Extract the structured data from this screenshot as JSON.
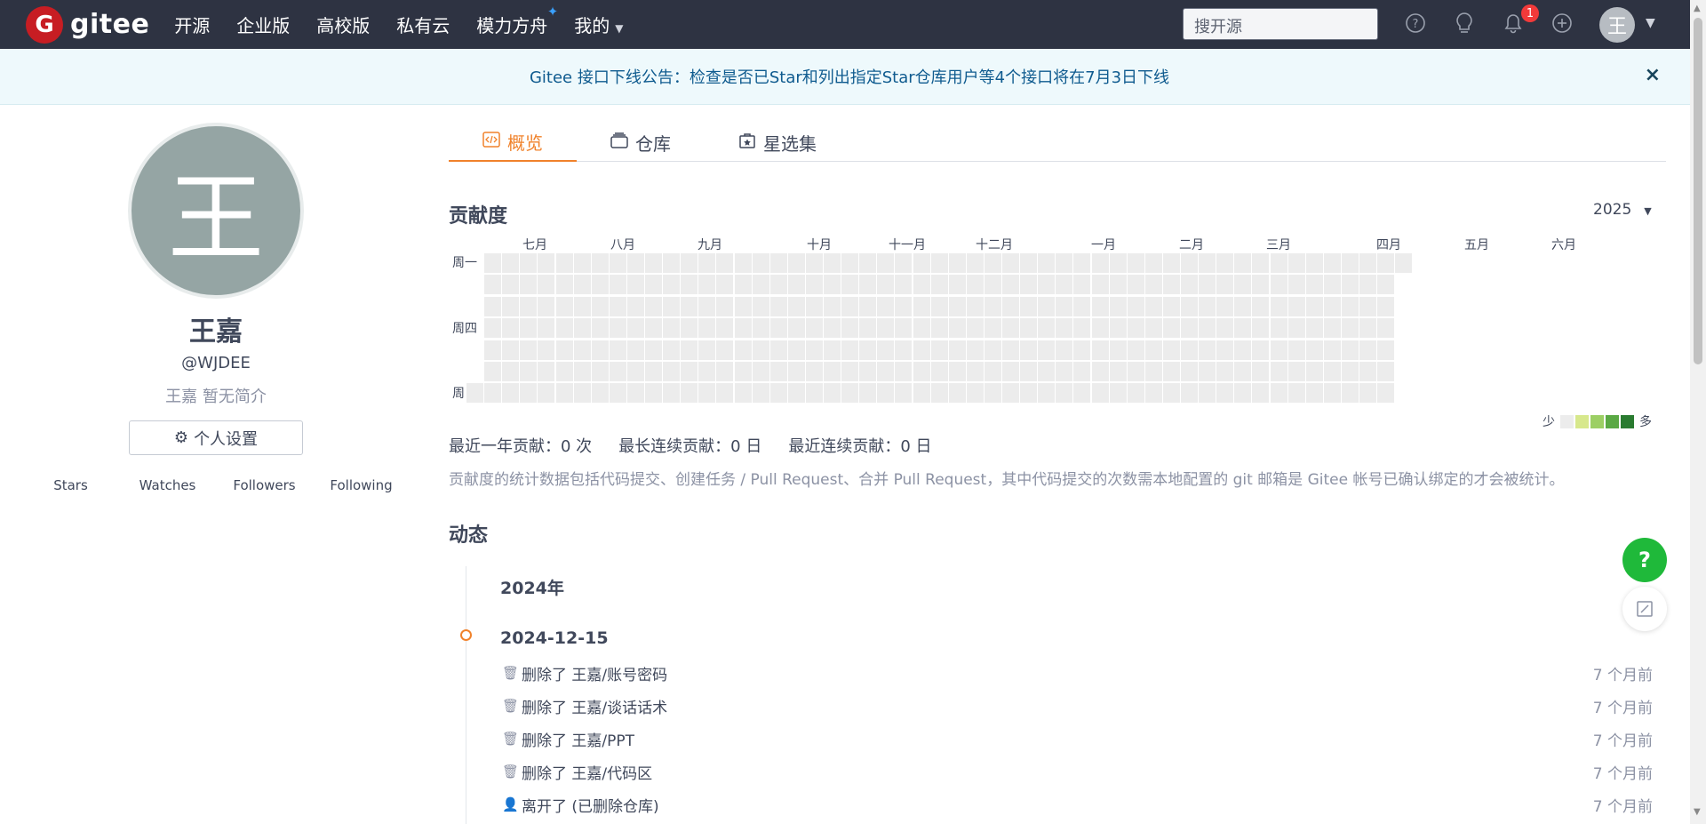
{
  "topnav": {
    "logo_letter": "G",
    "logo_text": "gitee",
    "links": [
      "开源",
      "企业版",
      "高校版",
      "私有云",
      "模力方舟",
      "我的"
    ],
    "search_placeholder": "搜开源",
    "notification_count": "1",
    "avatar_letter": "王"
  },
  "notice": {
    "text": "Gitee 接口下线公告：检查是否已Star和列出指定Star仓库用户等4个接口将在7月3日下线",
    "close": "×"
  },
  "profile": {
    "avatar_letter": "王",
    "name": "王嘉",
    "handle": "@WJDEE",
    "bio": "王嘉 暂无简介",
    "settings_label": "个人设置",
    "stats": [
      "Stars",
      "Watches",
      "Followers",
      "Following"
    ]
  },
  "tabs": [
    {
      "label": "概览",
      "icon": "code-icon",
      "active": true
    },
    {
      "label": "仓库",
      "icon": "repo-icon",
      "active": false
    },
    {
      "label": "星选集",
      "icon": "star-box-icon",
      "active": false
    }
  ],
  "contribution": {
    "title": "贡献度",
    "year": "2025",
    "months": [
      "七月",
      "八月",
      "九月",
      "十月",
      "十一月",
      "十二月",
      "一月",
      "二月",
      "三月",
      "四月",
      "五月",
      "六月"
    ],
    "day_labels": [
      "周一",
      "周四",
      "周日"
    ],
    "legend_less": "少",
    "legend_more": "多",
    "legend_colors": [
      "#ececec",
      "#d7e88c",
      "#9ccf64",
      "#5aa944",
      "#2a7b30"
    ],
    "weeks": 53,
    "days": 7,
    "total_label": "最近一年贡献：0 次",
    "longest_label": "最长连续贡献：0 日",
    "recent_label": "最近连续贡献：0 日",
    "note": "贡献度的统计数据包括代码提交、创建任务 / Pull Request、合并 Pull Request，其中代码提交的次数需本地配置的 git 邮箱是 Gitee 帐号已确认绑定的才会被统计。"
  },
  "activity": {
    "title": "动态",
    "year": "2024年",
    "date": "2024-12-15",
    "events": [
      {
        "icon": "trash-icon",
        "text": "删除了 王嘉/账号密码",
        "time": "7 个月前"
      },
      {
        "icon": "trash-icon",
        "text": "删除了 王嘉/谈话话术",
        "time": "7 个月前"
      },
      {
        "icon": "trash-icon",
        "text": "删除了 王嘉/PPT",
        "time": "7 个月前"
      },
      {
        "icon": "trash-icon",
        "text": "删除了 王嘉/代码区",
        "time": "7 个月前"
      },
      {
        "icon": "user-icon",
        "text": "离开了 (已删除仓库)",
        "time": "7 个月前"
      }
    ]
  },
  "fab": {
    "help": "?"
  }
}
